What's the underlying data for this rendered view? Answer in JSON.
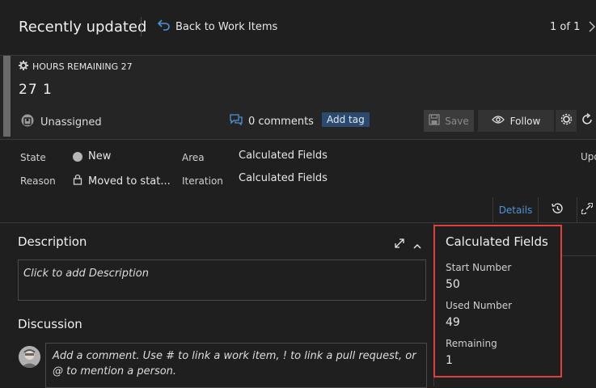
{
  "topbar": {
    "title": "Recently updated",
    "back_label": "Back to Work Items",
    "pager": "1 of 1"
  },
  "work_item": {
    "type_label": "HOURS REMAINING 27",
    "title": "27   1",
    "assignee": "Unassigned",
    "comments": "0 comments",
    "add_tag": "Add tag",
    "save_label": "Save",
    "follow_label": "Follow"
  },
  "fields": {
    "state_label": "State",
    "state_value": "New",
    "reason_label": "Reason",
    "reason_value": "Moved to stat...",
    "area_label": "Area",
    "area_value": "Calculated Fields",
    "iteration_label": "Iteration",
    "iteration_value": "Calculated Fields",
    "updated_label": "Upd"
  },
  "tabs": {
    "details": "Details"
  },
  "description": {
    "title": "Description",
    "placeholder": "Click to add Description"
  },
  "discussion": {
    "title": "Discussion",
    "placeholder": "Add a comment. Use # to link a work item, ! to link a pull request, or @ to mention a person."
  },
  "calculated": {
    "title": "Calculated Fields",
    "fields": [
      {
        "label": "Start Number",
        "value": "50"
      },
      {
        "label": "Used Number",
        "value": "49"
      },
      {
        "label": "Remaining",
        "value": "1"
      }
    ]
  },
  "colors": {
    "background": "#1f1f1f",
    "accent_blue": "#4f93d8",
    "highlight_red": "#e0403a",
    "tag_bg": "#2c4a6e"
  },
  "icons": [
    "back-arrow-icon",
    "chevron-right-icon",
    "gear-icon",
    "person-icon",
    "comment-icon",
    "save-icon",
    "eye-icon",
    "refresh-icon",
    "circle-icon",
    "lock-icon",
    "expand-icon",
    "chevron-up-icon",
    "history-icon",
    "link-icon"
  ]
}
